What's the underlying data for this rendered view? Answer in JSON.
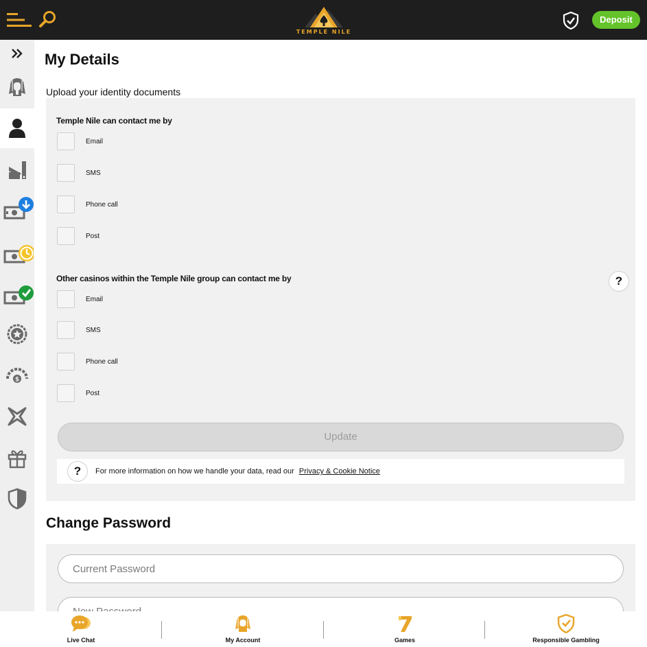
{
  "header": {
    "logo_text": "TEMPLE NILE",
    "deposit_label": "Deposit",
    "brand_color": "#e8a52a",
    "deposit_color": "#64c32a"
  },
  "sidebar": {
    "items": [
      {
        "icon": "double-chevron-right-icon"
      },
      {
        "icon": "pharaoh-icon"
      },
      {
        "icon": "user-icon",
        "active": true
      },
      {
        "icon": "stats-icon"
      },
      {
        "icon": "deposit-money-icon"
      },
      {
        "icon": "pending-withdrawal-icon"
      },
      {
        "icon": "verified-money-icon"
      },
      {
        "icon": "star-badge-icon"
      },
      {
        "icon": "limits-gauge-icon"
      },
      {
        "icon": "bonus-star-icon"
      },
      {
        "icon": "gift-icon"
      },
      {
        "icon": "shield-icon"
      }
    ]
  },
  "main": {
    "title": "My Details",
    "upload_link": "Upload your identity documents",
    "contact_section": {
      "label": "Temple Nile can contact me by",
      "options": [
        "Email",
        "SMS",
        "Phone call",
        "Post"
      ]
    },
    "group_section": {
      "label": "Other casinos within the Temple Nile group can contact me by",
      "help": "?",
      "options": [
        "Email",
        "SMS",
        "Phone call",
        "Post"
      ]
    },
    "update_label": "Update",
    "info": {
      "help": "?",
      "text": "For more information on how we handle your data, read our",
      "link": "Privacy & Cookie Notice"
    },
    "change_password": {
      "title": "Change Password",
      "current_placeholder": "Current Password",
      "new_placeholder": "New Password"
    }
  },
  "bottom_nav": [
    {
      "label": "Live Chat",
      "icon": "chat-bubble-icon"
    },
    {
      "label": "My Account",
      "icon": "pharaoh-account-icon"
    },
    {
      "label": "Games",
      "icon": "seven-icon"
    },
    {
      "label": "Responsible Gambling",
      "icon": "shield-check-icon"
    }
  ]
}
